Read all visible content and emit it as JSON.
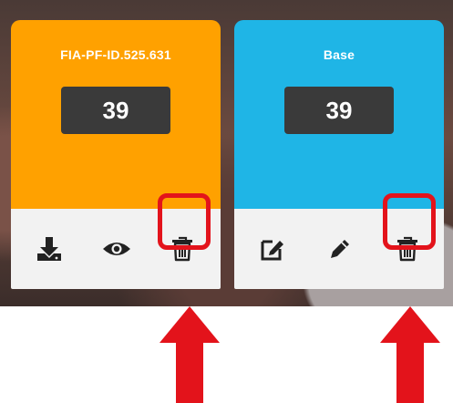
{
  "cards": [
    {
      "title": "FIA-PF-ID.525.631",
      "count": "39",
      "color": "#FFA100",
      "actions": [
        {
          "icon": "download-icon"
        },
        {
          "icon": "eye-icon"
        },
        {
          "icon": "trash-icon"
        }
      ]
    },
    {
      "title": "Base",
      "count": "39",
      "color": "#1FB5E6",
      "actions": [
        {
          "icon": "edit-square-icon"
        },
        {
          "icon": "pencil-icon"
        },
        {
          "icon": "trash-icon"
        }
      ]
    }
  ],
  "annotation_color": "#E3131B"
}
